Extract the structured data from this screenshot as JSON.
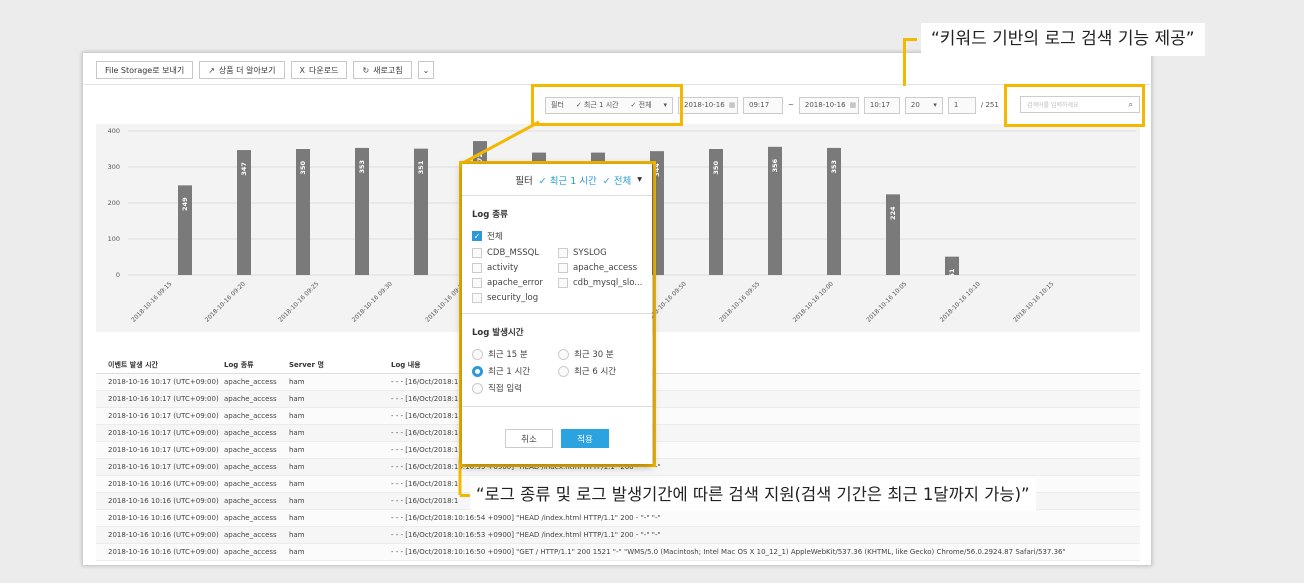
{
  "toolbar": {
    "file_storage_label": "File Storage로 보내기",
    "product_more_label": "상품 더 알아보기",
    "download_label": "다운로드",
    "refresh_label": "새로고침"
  },
  "controls": {
    "filter_label": "필터",
    "time_chip": "최근 1 시간",
    "all_chip": "전체",
    "start_date": "2018-10-16",
    "start_time": "09:17",
    "range_sep": "~",
    "end_date": "2018-10-16",
    "end_time": "10:17",
    "page_size": "20",
    "page_num": "1",
    "page_total": "/ 251",
    "search_placeholder": "검색어를 입력하세요"
  },
  "chart_data": {
    "type": "bar",
    "categories": [
      "2018-10-16 09:15",
      "2018-10-16 09:20",
      "2018-10-16 09:25",
      "2018-10-16 09:30",
      "2018-10-16 09:35",
      "2018-10-16 09:40",
      "2018-10-16 09:45",
      "2018-10-16 09:50",
      "2018-10-16 09:55",
      "2018-10-16 10:00",
      "2018-10-16 10:05",
      "2018-10-16 10:10",
      "2018-10-16 10:15"
    ],
    "values": [
      249,
      347,
      350,
      353,
      351,
      372,
      340,
      340,
      344,
      350,
      356,
      353,
      224,
      51
    ],
    "bar_labels": [
      "249",
      "347",
      "350",
      "353",
      "351",
      "372",
      "340",
      "340",
      "344",
      "350",
      "356",
      "353",
      "224",
      "51"
    ],
    "ylim": [
      0,
      400
    ],
    "yticks": [
      "400",
      "300",
      "200",
      "100",
      "0"
    ]
  },
  "table": {
    "headers": [
      "이벤트 발생 시간",
      "Log 종류",
      "Server 명",
      "Log 내용"
    ],
    "rows": [
      [
        "2018-10-16 10:17 (UTC+09:00)",
        "apache_access",
        "ham",
        "- - - [16/Oct/2018:1"
      ],
      [
        "2018-10-16 10:17 (UTC+09:00)",
        "apache_access",
        "ham",
        "- - - [16/Oct/2018:1"
      ],
      [
        "2018-10-16 10:17 (UTC+09:00)",
        "apache_access",
        "ham",
        "- - - [16/Oct/2018:1"
      ],
      [
        "2018-10-16 10:17 (UTC+09:00)",
        "apache_access",
        "ham",
        "- - - [16/Oct/2018:1"
      ],
      [
        "2018-10-16 10:17 (UTC+09:00)",
        "apache_access",
        "ham",
        "- - - [16/Oct/2018:1"
      ],
      [
        "2018-10-16 10:17 (UTC+09:00)",
        "apache_access",
        "ham",
        "- - - [16/Oct/2018:10:16:59 +0900] \"HEAD /index.html HTTP/1.1\" 200 - \"-\" \"-\""
      ],
      [
        "2018-10-16 10:16 (UTC+09:00)",
        "apache_access",
        "ham",
        "- - - [16/Oct/2018:1"
      ],
      [
        "2018-10-16 10:16 (UTC+09:00)",
        "apache_access",
        "ham",
        "- - - [16/Oct/2018:1"
      ],
      [
        "2018-10-16 10:16 (UTC+09:00)",
        "apache_access",
        "ham",
        "- - - [16/Oct/2018:10:16:54 +0900] \"HEAD /index.html HTTP/1.1\" 200 - \"-\" \"-\""
      ],
      [
        "2018-10-16 10:16 (UTC+09:00)",
        "apache_access",
        "ham",
        "- - - [16/Oct/2018:10:16:53 +0900] \"HEAD /index.html HTTP/1.1\" 200 - \"-\" \"-\""
      ],
      [
        "2018-10-16 10:16 (UTC+09:00)",
        "apache_access",
        "ham",
        "- - - [16/Oct/2018:10:16:50 +0900] \"GET / HTTP/1.1\" 200 1521 \"-\" \"WMS/5.0 (Macintosh; Intel Mac OS X 10_12_1) AppleWebKit/537.36 (KHTML, like Gecko) Chrome/56.0.2924.87 Safari/537.36\""
      ]
    ]
  },
  "popup": {
    "filter_label": "필터",
    "time_chip": "최근 1 시간",
    "all_chip": "전체",
    "log_type_title": "Log 종류",
    "all_option": "전체",
    "log_types": [
      "CDB_MSSQL",
      "SYSLOG",
      "activity",
      "apache_access",
      "apache_error",
      "cdb_mysql_slo...",
      "security_log"
    ],
    "period_title": "Log 발생시간",
    "periods": [
      "최근 15 분",
      "최근 30 분",
      "최근 1 시간",
      "최근 6 시간",
      "직접 입력"
    ],
    "cancel_label": "취소",
    "apply_label": "적용"
  },
  "callouts": {
    "top": "“키워드 기반의 로그 검색 기능 제공”",
    "bottom": "“로그 종류 및 로그 발생기간에 따른 검색 지원(검색 기간은 최근 1달까지 가능)”"
  },
  "colors": {
    "accent": "#2b9ad6",
    "highlight": "#f5b800",
    "bar": "#7a7a7a"
  }
}
